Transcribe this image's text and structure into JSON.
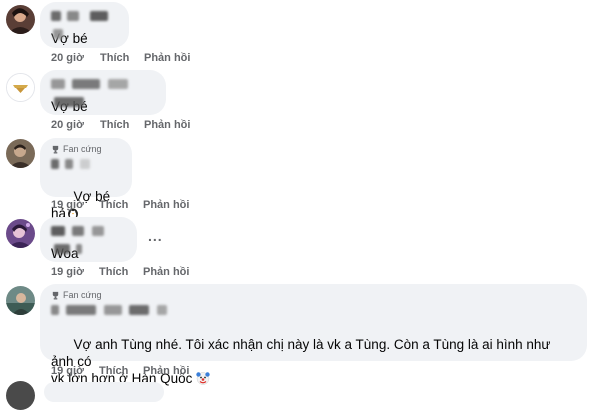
{
  "comments": [
    {
      "author": "",
      "badge": "",
      "text": "Vợ bé",
      "time": "20 giờ",
      "like": "Thích",
      "reply": "Phản hồi"
    },
    {
      "author": "",
      "badge": "",
      "text": "Vợ bé",
      "time": "20 giờ",
      "like": "Thích",
      "reply": "Phản hồi"
    },
    {
      "author": "",
      "badge": "Fan cứng",
      "text": "Vợ bé hả",
      "emoji": "penguin-emoji",
      "time": "19 giờ",
      "like": "Thích",
      "reply": "Phản hồi"
    },
    {
      "author": "",
      "badge": "",
      "text": "Woa",
      "time": "19 giờ",
      "like": "Thích",
      "reply": "Phản hồi",
      "more": "..."
    },
    {
      "author": "",
      "badge": "Fan cứng",
      "text": "Vợ anh Tùng nhé. Tôi xác nhận chị này là vk a Tùng. Còn a Tùng là ai hình như ảnh có\nvk lớn hơn ở Hàn Quốc",
      "emoji": "clown-face-emoji",
      "time": "19 giờ",
      "like": "Thích",
      "reply": "Phản hồi"
    }
  ],
  "colors": {
    "bubble": "#f0f2f5",
    "secondary_text": "#65676b",
    "primary_text": "#050505"
  }
}
